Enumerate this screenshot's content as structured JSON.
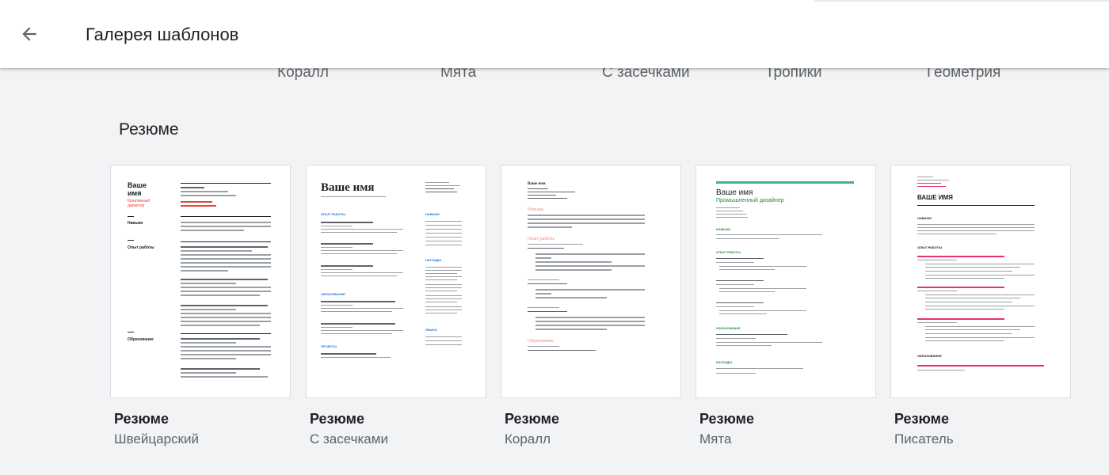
{
  "header": {
    "title": "Галерея шаблонов",
    "back_icon": "arrow-back-icon"
  },
  "previous_row": {
    "labels": [
      "Коралл",
      "Мята",
      "С засечками",
      "Тропики",
      "Геометрия"
    ]
  },
  "section": {
    "title": "Резюме"
  },
  "templates": [
    {
      "title": "Резюме",
      "subtitle": "Швейцарский",
      "preview": {
        "name": "Ваше имя",
        "role": "Креативный директор",
        "s1": "Навыки",
        "s2": "Опыт работы",
        "s3": "Образование",
        "accent": "#ea4335"
      }
    },
    {
      "title": "Резюме",
      "subtitle": "С засечками",
      "preview": {
        "name": "Ваше имя",
        "s1": "ОПЫТ РАБОТЫ",
        "s2": "ОБРАЗОВАНИЕ",
        "s3": "ПРОЕКТЫ",
        "side1": "НАВЫКИ",
        "side2": "НАГРАДЫ",
        "side3": "ЯЗЫКИ",
        "accent": "#1a73e8"
      }
    },
    {
      "title": "Резюме",
      "subtitle": "Коралл",
      "preview": {
        "name": "Ваше имя",
        "s1": "Навыки",
        "s2": "Опыт работы",
        "s3": "Образование",
        "accent": "#f28b82"
      }
    },
    {
      "title": "Резюме",
      "subtitle": "Мята",
      "preview": {
        "name": "Ваше имя",
        "role": "Промышленный дизайнер",
        "s1": "НАВЫКИ",
        "s2": "ОПЫТ РАБОТЫ",
        "s3": "ОБРАЗОВАНИЕ",
        "s4": "НАГРАДЫ",
        "accent": "#1e8e3e"
      }
    },
    {
      "title": "Резюме",
      "subtitle": "Писатель",
      "preview": {
        "name": "ВАШЕ ИМЯ",
        "s1": "НАВЫКИ",
        "s2": "ОПЫТ РАБОТЫ",
        "s3": "ОБРАЗОВАНИЕ",
        "accent": "#e8336d"
      }
    }
  ]
}
